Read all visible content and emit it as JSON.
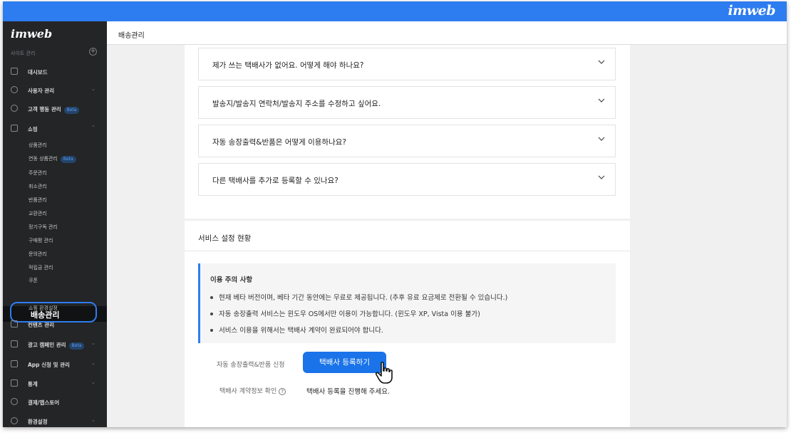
{
  "topbar": {
    "brand": "imweb"
  },
  "sidebar": {
    "logo": "imweb",
    "site_label": "사이트 관리",
    "items": [
      {
        "label": "대시보드",
        "icon": "grid-icon"
      },
      {
        "label": "사용자 관리",
        "icon": "user-icon"
      },
      {
        "label": "고객 행동 관리",
        "badge": "Beta",
        "icon": "target-icon"
      },
      {
        "label": "쇼핑",
        "icon": "shopping-bag-icon"
      }
    ],
    "shopping_sub": [
      "상품관리",
      "연동 상품관리",
      "주문관리",
      "취소관리",
      "반품관리",
      "교환관리",
      "정기구독 관리",
      "구매평 관리",
      "문의관리",
      "적립금 관리",
      "쿠폰"
    ],
    "sub_badge": "Beta",
    "active_item": "배송관리",
    "after_active": "쇼핑 환경설정",
    "bottom_items": [
      {
        "label": "컨텐츠 관리",
        "icon": "edit-icon"
      },
      {
        "label": "광고 캠페인 관리",
        "badge": "Beta",
        "icon": "megaphone-icon"
      },
      {
        "label": "App 신청 및 관리",
        "icon": "mobile-icon"
      },
      {
        "label": "통계",
        "icon": "chart-icon"
      },
      {
        "label": "결제/앱스토어",
        "icon": "rocket-icon"
      },
      {
        "label": "환경설정",
        "icon": "settings-icon"
      }
    ]
  },
  "header": {
    "breadcrumb": "배송관리"
  },
  "faq": [
    "제가 쓰는 택배사가 없어요. 어떻게 해야 하나요?",
    "발송지/발송지 연락처/발송지 주소를 수정하고 싶어요.",
    "자동 송장출력&반품은 어떻게 이용하나요?",
    "다른 택배사를 추가로 등록할 수 있나요?"
  ],
  "service": {
    "title": "서비스 설정 현황",
    "notice_title": "이용 주의 사항",
    "notice_lines": [
      "현재 베타 버전이며, 베타 기간 동안에는 무료로 제공됩니다. (추후 유료 요금제로 전환될 수 있습니다.)",
      "자동 송장출력 서비스는 윈도우 OS에서만 이용이 가능합니다. (윈도우 XP, Vista 이용 불가)",
      "서비스 이용을 위해서는 택배사 계약이 완료되어야 합니다."
    ],
    "apply_label": "자동 송장출력&반품 신청",
    "register_button": "택배사 등록하기",
    "contract_label": "택배사 계약정보 확인",
    "contract_value": "택배사 등록을 진행해 주세요."
  }
}
